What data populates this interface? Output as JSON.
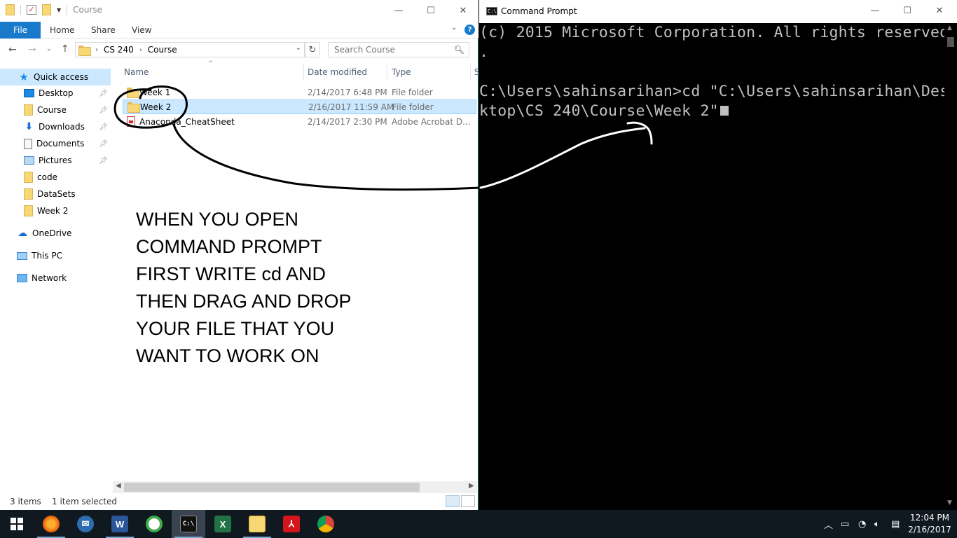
{
  "explorer": {
    "title": "Course",
    "ribbon_tabs": {
      "file": "File",
      "home": "Home",
      "share": "Share",
      "view": "View"
    },
    "address": {
      "segments": [
        "CS 240",
        "Course"
      ]
    },
    "search_placeholder": "Search Course",
    "nav": {
      "quick_access": "Quick access",
      "items": [
        {
          "label": "Desktop",
          "pinned": true
        },
        {
          "label": "Course",
          "pinned": true
        },
        {
          "label": "Downloads",
          "pinned": true
        },
        {
          "label": "Documents",
          "pinned": true
        },
        {
          "label": "Pictures",
          "pinned": true
        },
        {
          "label": "code"
        },
        {
          "label": "DataSets"
        },
        {
          "label": "Week 2"
        }
      ],
      "onedrive": "OneDrive",
      "this_pc": "This PC",
      "network": "Network"
    },
    "columns": {
      "name": "Name",
      "date": "Date modified",
      "type": "Type",
      "size_initial": "S"
    },
    "files": [
      {
        "name": "Week 1",
        "date": "2/14/2017 6:48 PM",
        "type": "File folder"
      },
      {
        "name": "Week 2",
        "date": "2/16/2017 11:59 AM",
        "type": "File folder",
        "selected": true
      },
      {
        "name": "Anaconda_CheatSheet",
        "date": "2/14/2017 2:30 PM",
        "type": "Adobe Acrobat D..."
      }
    ],
    "status": {
      "items": "3 items",
      "selected": "1 item selected"
    }
  },
  "instructions": [
    "WHEN YOU OPEN",
    "COMMAND PROMPT",
    "FIRST WRITE cd AND",
    "THEN DRAG AND DROP",
    "YOUR FILE THAT YOU",
    "WANT TO WORK ON"
  ],
  "cmd": {
    "title": "Command Prompt",
    "lines": [
      "(c) 2015 Microsoft Corporation. All rights reserved",
      ".",
      "",
      "C:\\Users\\sahinsarihan>cd \"C:\\Users\\sahinsarihan\\Des",
      "ktop\\CS 240\\Course\\Week 2\""
    ]
  },
  "taskbar": {
    "apps": [
      "start",
      "firefox",
      "thunderbird",
      "word",
      "app-green",
      "cmd",
      "excel",
      "file-explorer",
      "acrobat",
      "chrome"
    ],
    "clock": {
      "time": "12:04 PM",
      "date": "2/16/2017"
    }
  },
  "colors": {
    "accent": "#1979ca",
    "selection": "#cce8ff",
    "taskbar": "#101820",
    "cmd_text": "#c0c0c0"
  }
}
